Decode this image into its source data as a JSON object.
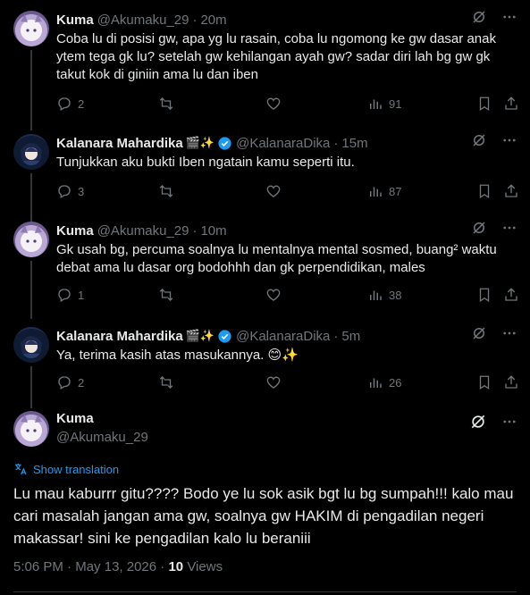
{
  "replies": [
    {
      "name": "Kuma",
      "emoji": "",
      "handle": "@Akumaku_29",
      "time": "20m",
      "text": "Coba lu di posisi gw, apa yg lu rasain, coba lu ngomong ke gw dasar anak ytem tega gk lu? setelah gw kehilangan ayah gw? sadar diri lah bg gw gk takut kok di giniin ama lu dan iben",
      "reply_count": "2",
      "retweet_count": "",
      "like_count": "",
      "view_count": "91"
    },
    {
      "name": "Kalanara Mahardika",
      "emoji": "🎬✨",
      "handle": "@KalanaraDika",
      "time": "15m",
      "text": "Tunjukkan aku bukti Iben ngatain kamu seperti itu.",
      "reply_count": "3",
      "retweet_count": "",
      "like_count": "",
      "view_count": "87"
    },
    {
      "name": "Kuma",
      "emoji": "",
      "handle": "@Akumaku_29",
      "time": "10m",
      "text": "Gk usah bg, percuma soalnya lu mentalnya mental sosmed, buang² waktu debat ama lu dasar org bodohhh dan gk perpendidikan, males",
      "reply_count": "1",
      "retweet_count": "",
      "like_count": "",
      "view_count": "38"
    },
    {
      "name": "Kalanara Mahardika",
      "emoji": "🎬✨",
      "handle": "@KalanaraDika",
      "time": "5m",
      "text": "Ya, terima kasih atas masukannya. 😊✨",
      "reply_count": "2",
      "retweet_count": "",
      "like_count": "",
      "view_count": "26"
    }
  ],
  "main": {
    "name": "Kuma",
    "handle": "@Akumaku_29",
    "show_translation": "Show translation",
    "text": "Lu mau kaburrr gitu???? Bodo ye lu sok asik bgt lu bg sumpah!!! kalo mau cari masalah jangan ama gw, soalnya gw HAKIM di pengadilan negeri makassar! sini ke pengadilan kalo lu beraniii",
    "time": "5:06 PM",
    "sep1": "·",
    "date": "May 13, 2026",
    "sep2": "·",
    "views_count": "10",
    "views_label": "Views"
  },
  "colors": {
    "background": "#000000",
    "text": "#e7e9ea",
    "muted": "#71767b",
    "link": "#1d9bf0",
    "verified": "#1d9bf0"
  }
}
